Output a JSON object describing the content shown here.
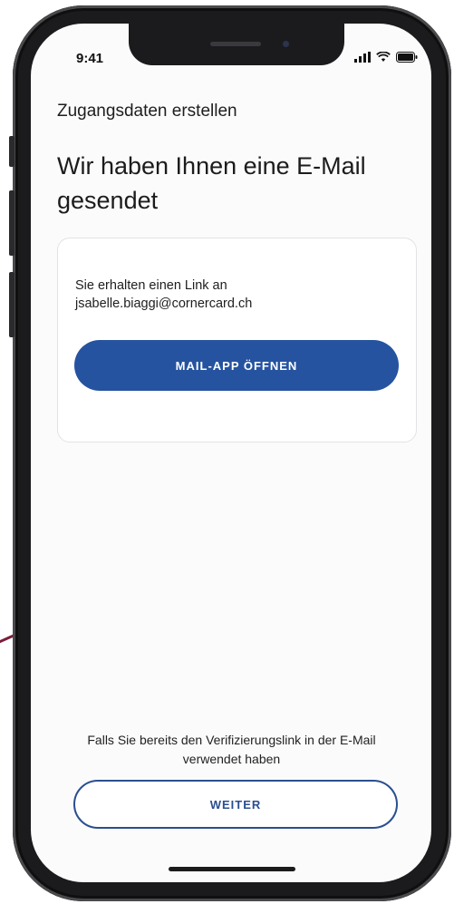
{
  "status_bar": {
    "time": "9:41",
    "signal_icon": "cellular-signal-icon",
    "wifi_icon": "wifi-icon",
    "battery_icon": "battery-icon"
  },
  "header": {
    "title": "Zugangsdaten erstellen"
  },
  "main": {
    "heading": "Wir haben Ihnen eine E-Mail gesendet",
    "card": {
      "text_line1": "Sie erhalten einen Link an",
      "text_line2": "jsabelle.biaggi@cornercard.ch",
      "open_mail_label": "MAIL-APP ÖFFNEN"
    }
  },
  "footer": {
    "hint": "Falls Sie bereits den Verifizierungslink in der E-Mail verwendet haben",
    "continue_label": "WEITER"
  },
  "colors": {
    "primary": "#2553a0",
    "outline": "#2b4f8f",
    "background": "#fbfbfc"
  }
}
